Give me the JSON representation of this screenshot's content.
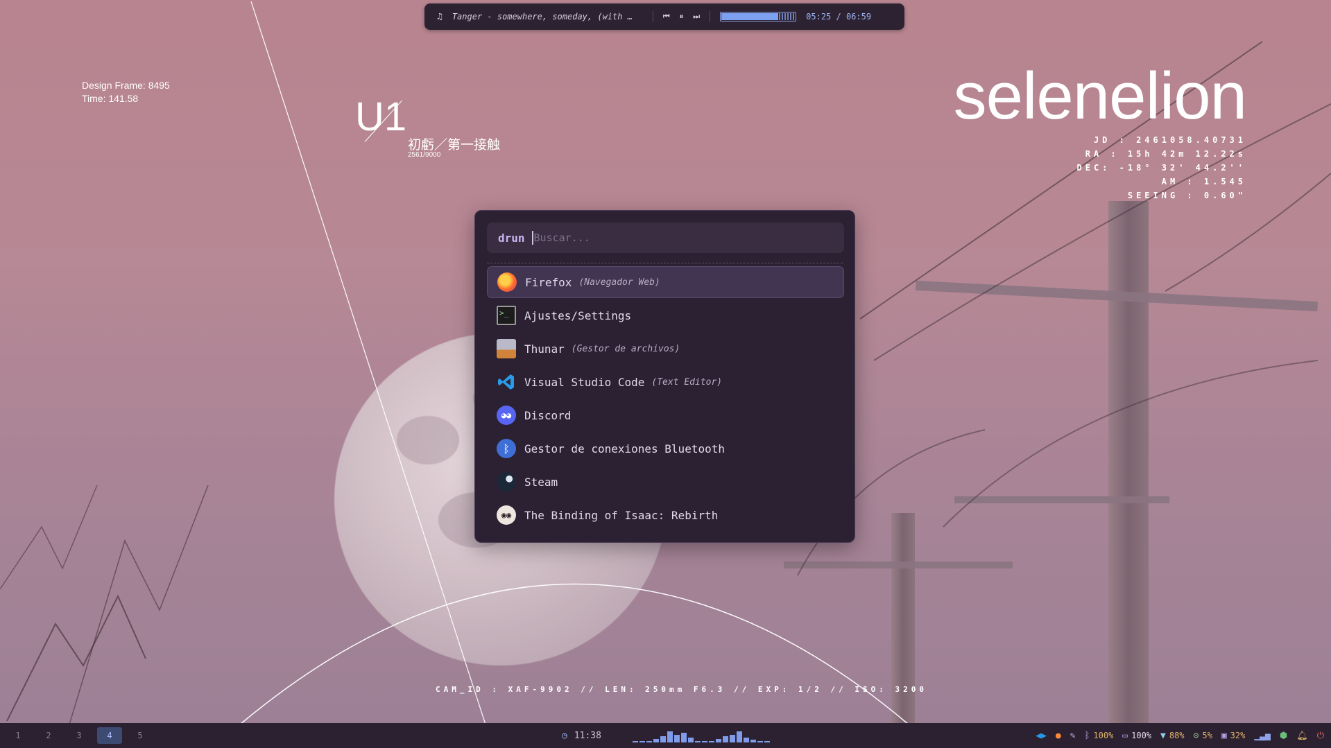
{
  "music": {
    "title": "Tanger - somewhere, someday, (with …",
    "position": "05:25",
    "duration": "06:59",
    "time_text": "05:25 / 06:59",
    "progress_fraction": 0.776
  },
  "hud": {
    "design_frame": "Design Frame: 8495",
    "time": "Time: 141.58",
    "chapter": "U1",
    "chapter_sub": "初虧／第一接触",
    "chapter_count": "2561/9000",
    "name": "selenelion",
    "astro_lines": [
      "JD : 2461058.40731",
      "RA : 15h 42m 12.22s",
      "DEC: -18° 32' 44.2''",
      "AM : 1.545",
      "SEEING : 0.60\""
    ],
    "cam_info": "CAM_ID : XAF-9902 // LEN: 250mm F6.3 // EXP: 1/2 // ISO: 3200"
  },
  "launcher": {
    "mode": "drun",
    "search_value": "",
    "placeholder": "Buscar...",
    "apps": [
      {
        "name": "Firefox",
        "desc": "(Navegador Web)",
        "icon": "firefox-icon",
        "selected": true
      },
      {
        "name": "Ajustes/Settings",
        "desc": "",
        "icon": "terminal-icon",
        "selected": false
      },
      {
        "name": "Thunar",
        "desc": "(Gestor de archivos)",
        "icon": "file-manager-icon",
        "selected": false
      },
      {
        "name": "Visual Studio Code",
        "desc": "(Text Editor)",
        "icon": "vscode-icon",
        "selected": false
      },
      {
        "name": "Discord",
        "desc": "",
        "icon": "discord-icon",
        "selected": false
      },
      {
        "name": "Gestor de conexiones Bluetooth",
        "desc": "",
        "icon": "bluetooth-icon",
        "selected": false
      },
      {
        "name": "Steam",
        "desc": "",
        "icon": "steam-icon",
        "selected": false
      },
      {
        "name": "The Binding of Isaac: Rebirth",
        "desc": "",
        "icon": "isaac-icon",
        "selected": false
      }
    ]
  },
  "taskbar": {
    "workspaces": [
      "1",
      "2",
      "3",
      "4",
      "5"
    ],
    "active_workspace": "4",
    "clock": "11:38",
    "cava_levels": [
      0.1,
      0.1,
      0.1,
      0.3,
      0.5,
      0.9,
      0.6,
      0.8,
      0.4,
      0.1,
      0.1,
      0.1,
      0.3,
      0.5,
      0.6,
      0.9,
      0.4,
      0.2,
      0.1,
      0.1
    ],
    "tray": {
      "bluetooth": "100%",
      "notifications": "100%",
      "wifi": "88%",
      "cpu": "5%",
      "memory": "32%"
    },
    "colors": {
      "accent": "#7ea0f0",
      "bar_bg": "#2b2130",
      "warm": "#e2b26b"
    }
  }
}
